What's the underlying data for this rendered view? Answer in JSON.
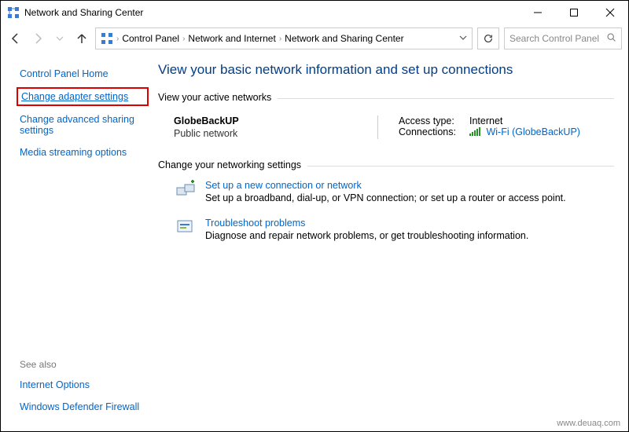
{
  "window": {
    "title": "Network and Sharing Center"
  },
  "breadcrumb": {
    "a": "Control Panel",
    "b": "Network and Internet",
    "c": "Network and Sharing Center"
  },
  "search": {
    "placeholder": "Search Control Panel"
  },
  "sidebar": {
    "home": "Control Panel Home",
    "adapter": "Change adapter settings",
    "advanced": "Change advanced sharing settings",
    "media": "Media streaming options",
    "seealso": "See also",
    "inetopt": "Internet Options",
    "firewall": "Windows Defender Firewall"
  },
  "main": {
    "heading": "View your basic network information and set up connections",
    "active_label": "View your active networks",
    "network": {
      "name": "GlobeBackUP",
      "type": "Public network",
      "access_k": "Access type:",
      "access_v": "Internet",
      "conn_k": "Connections:",
      "conn_v": "Wi-Fi (GlobeBackUP)"
    },
    "change_label": "Change your networking settings",
    "setup": {
      "title": "Set up a new connection or network",
      "desc": "Set up a broadband, dial-up, or VPN connection; or set up a router or access point."
    },
    "trouble": {
      "title": "Troubleshoot problems",
      "desc": "Diagnose and repair network problems, or get troubleshooting information."
    }
  },
  "watermark": "www.deuaq.com"
}
